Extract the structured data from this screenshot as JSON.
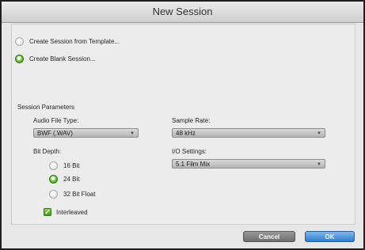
{
  "window": {
    "title": "New Session"
  },
  "options": {
    "template_label": "Create Session from Template...",
    "blank_label": "Create Blank Session..."
  },
  "parameters": {
    "section_label": "Session Parameters",
    "audio_file_type": {
      "label": "Audio File Type:",
      "value": "BWF (.WAV)"
    },
    "sample_rate": {
      "label": "Sample Rate:",
      "value": "48 kHz"
    },
    "bit_depth": {
      "label": "Bit Depth:",
      "options": [
        "16 Bit",
        "24 Bit",
        "32 Bit Float"
      ],
      "selected": "24 Bit"
    },
    "io_settings": {
      "label": "I/O Settings:",
      "value": "5.1 Film Mix"
    },
    "interleaved_label": "Interleaved"
  },
  "buttons": {
    "cancel": "Cancel",
    "ok": "OK"
  },
  "colors": {
    "accent_green": "#3d9416",
    "ok_blue": "#2e7dd0"
  }
}
